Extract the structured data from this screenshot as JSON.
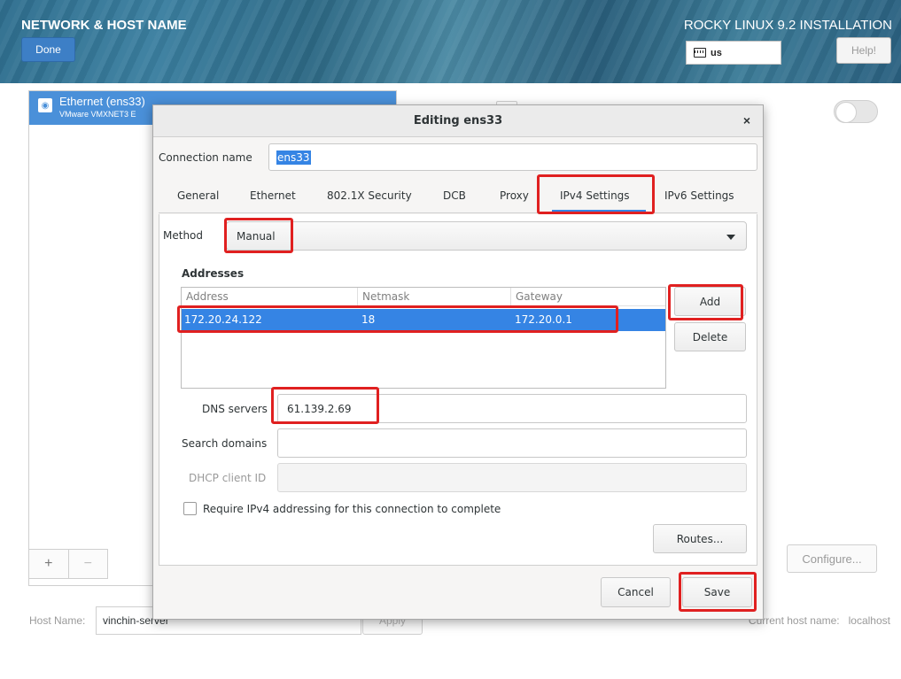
{
  "header": {
    "title": "NETWORK & HOST NAME",
    "done_label": "Done",
    "product": "ROCKY LINUX 9.2 INSTALLATION",
    "keyboard_layout": "us",
    "help_label": "Help!"
  },
  "device": {
    "name": "Ethernet (ens33)",
    "subtitle": "VMware VMXNET3 E"
  },
  "list_tools": {
    "add": "+",
    "remove": "−"
  },
  "configure_label": "Configure...",
  "hostname": {
    "label": "Host Name:",
    "value": "vinchin-server",
    "apply_label": "Apply",
    "current_label": "Current host name:",
    "current_value": "localhost"
  },
  "dialog": {
    "title": "Editing ens33",
    "close_symbol": "×",
    "connection_name_label": "Connection name",
    "connection_name_value": "ens33",
    "tabs": [
      {
        "label": "General"
      },
      {
        "label": "Ethernet"
      },
      {
        "label": "802.1X Security"
      },
      {
        "label": "DCB"
      },
      {
        "label": "Proxy"
      },
      {
        "label": "IPv4 Settings"
      },
      {
        "label": "IPv6 Settings"
      }
    ],
    "active_tab": "IPv4 Settings",
    "method_label": "Method",
    "method_value": "Manual",
    "addresses_heading": "Addresses",
    "address_columns": [
      "Address",
      "Netmask",
      "Gateway"
    ],
    "address_rows": [
      {
        "address": "172.20.24.122",
        "netmask": "18",
        "gateway": "172.20.0.1"
      }
    ],
    "add_label": "Add",
    "delete_label": "Delete",
    "dns_label": "DNS servers",
    "dns_value": "61.139.2.69",
    "search_domains_label": "Search domains",
    "search_domains_value": "",
    "dhcp_client_id_label": "DHCP client ID",
    "dhcp_client_id_value": "",
    "require_ipv4_label": "Require IPv4 addressing for this connection to complete",
    "require_ipv4_checked": false,
    "routes_label": "Routes...",
    "cancel_label": "Cancel",
    "save_label": "Save"
  },
  "colors": {
    "selection": "#3584e4",
    "header_selection": "#4a90d9",
    "annotation": "#e02020",
    "done_button": "#3d7fc6"
  }
}
